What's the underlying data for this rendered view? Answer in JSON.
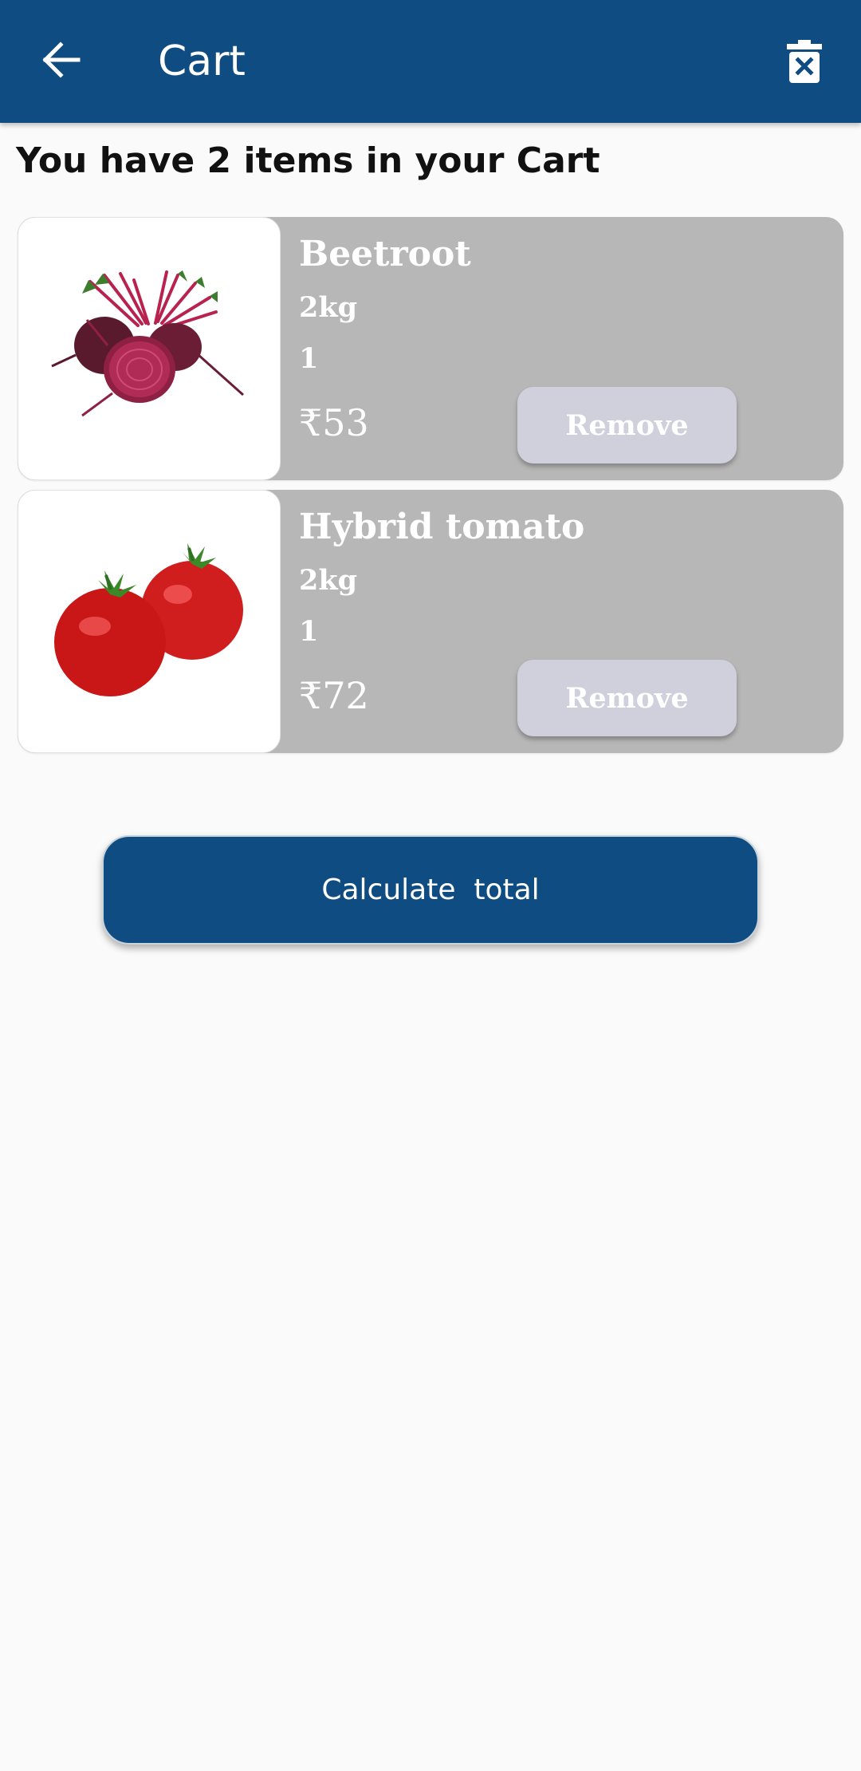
{
  "appbar": {
    "title": "Cart",
    "back_icon": "arrow-back-icon",
    "clear_icon": "trash-x-icon",
    "color": "#0f4c81"
  },
  "summary": "You have 2 items in your Cart",
  "items": [
    {
      "name": "Beetroot",
      "weight": "2kg",
      "quantity": "1",
      "price": "₹53",
      "image_icon": "beetroot-image",
      "remove_label": "Remove"
    },
    {
      "name": "Hybrid tomato",
      "weight": "2kg",
      "quantity": "1",
      "price": "₹72",
      "image_icon": "tomato-image",
      "remove_label": "Remove"
    }
  ],
  "calculate_label": "Calculate  total",
  "colors": {
    "card": "#b7b7b7",
    "remove_button": "#d0d0dc",
    "background": "#fafafa"
  }
}
